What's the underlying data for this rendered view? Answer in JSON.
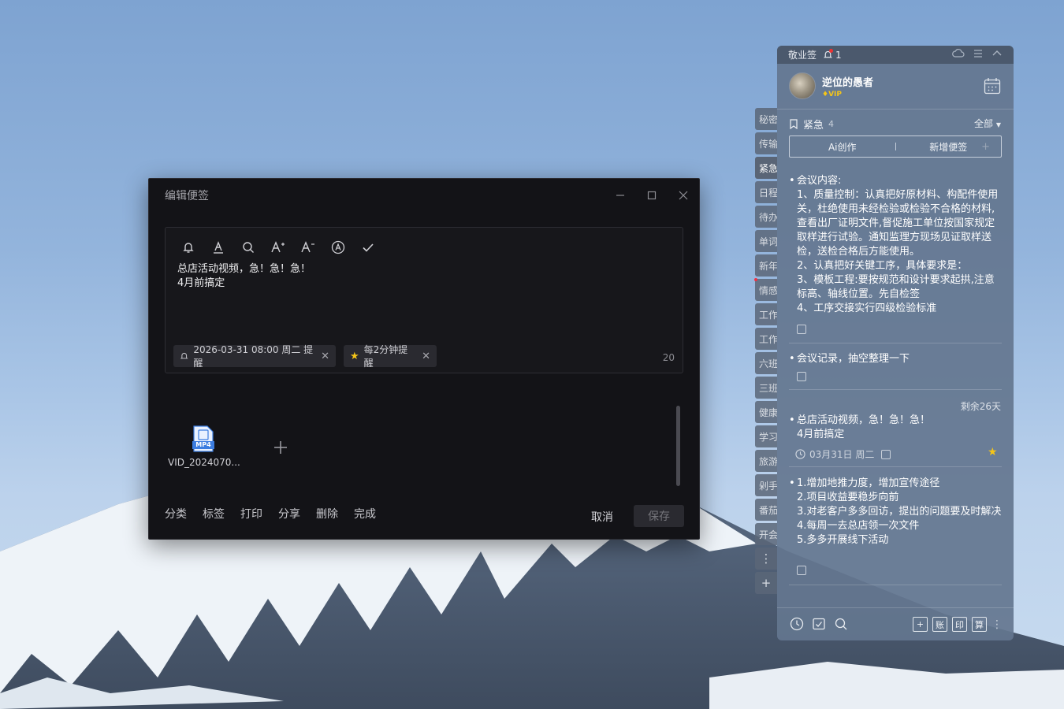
{
  "edit_window": {
    "title": "编辑便签",
    "note_line1": "总店活动视频，急！急！急！",
    "note_line2": "4月前搞定",
    "reminder_tag": "2026-03-31 08:00 周二 提醒",
    "repeat_tag": "每2分钟提醒",
    "char_count": "20",
    "attachment_label": "MP4",
    "attachment_name": "VID_2024070...",
    "bottom_actions": [
      "分类",
      "标签",
      "打印",
      "分享",
      "删除",
      "完成"
    ],
    "cancel_label": "取消",
    "save_label": "保存"
  },
  "side_tabs": [
    "秘密",
    "传输",
    "紧急",
    "日程",
    "待办",
    "单词",
    "新年",
    "情感",
    "工作",
    "工作",
    "六班",
    "三班",
    "健康",
    "学习",
    "旅游",
    "剁手",
    "番茄",
    "开会"
  ],
  "panel": {
    "app_name": "敬业签",
    "notif_count": "1",
    "user_name": "逆位的愚者",
    "vip_label": "VIP",
    "category": "紧急",
    "category_count": "4",
    "filter_label": "全部",
    "ai_label": "Ai创作",
    "new_note_label": "新增便签",
    "notes": [
      {
        "text": "会议内容:\n1、质量控制：认真把好原材料、构配件使用关，杜绝使用未经检验或检验不合格的材料,查看出厂证明文件,督促施工单位按国家规定取样进行试验。通知监理方现场见证取样送检，送检合格后方能使用。\n2、认真把好关键工序，具体要求是：\n3、模板工程:要按规范和设计要求起拱,注意标高、轴线位置。先自检签\n4、工序交接实行四级检验标准"
      },
      {
        "text": "会议记录，抽空整理一下"
      },
      {
        "text": "总店活动视频，急！急！急！\n4月前搞定",
        "date": "03月31日 周二",
        "remaining": "剩余26天"
      },
      {
        "text": "1.增加地推力度，增加宣传途径\n2.项目收益要稳步向前\n3.对老客户多多回访，提出的问题要及时解决\n4.每周一去总店领一次文件\n5.多多开展线下活动"
      }
    ],
    "bottom_tools": [
      "账",
      "印",
      "算"
    ]
  },
  "colors": {
    "editor_bg": "#131317",
    "panel_bg": "#64768f",
    "accent_star": "#f5c518",
    "alert_red": "#e33333"
  }
}
